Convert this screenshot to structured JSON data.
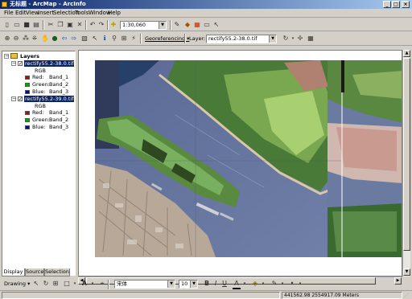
{
  "window": {
    "title": "无标题 - ArcMap - ArcInfo"
  },
  "menu": {
    "items": [
      "File",
      "Edit",
      "View",
      "Insert",
      "Selection",
      "Tools",
      "Window",
      "Help"
    ]
  },
  "standard_toolbar": {
    "scale_value": "1:30,060"
  },
  "georef_toolbar": {
    "georeferencing_label": "Georeferencing ▾",
    "layer_label": "Layer:",
    "layer_value": "rectify55.2-38.0.tif"
  },
  "toc": {
    "root_label": "Layers",
    "layers": [
      {
        "name": "rectify55.2-38.0.tif",
        "render": "RGB",
        "bands": [
          {
            "label": "Red:",
            "band": "Band_1",
            "color": "#cc0000"
          },
          {
            "label": "Green:",
            "band": "Band_2",
            "color": "#00aa00"
          },
          {
            "label": "Blue:",
            "band": "Band_3",
            "color": "#0000cc"
          }
        ]
      },
      {
        "name": "rectify55.2-39.0.tif",
        "render": "RGB",
        "bands": [
          {
            "label": "Red:",
            "band": "Band_1",
            "color": "#cc0000"
          },
          {
            "label": "Green:",
            "band": "Band_2",
            "color": "#00aa00"
          },
          {
            "label": "Blue:",
            "band": "Band_3",
            "color": "#0000cc"
          }
        ]
      }
    ],
    "tabs": [
      "Display",
      "Source",
      "Selection"
    ]
  },
  "draw_toolbar": {
    "drawing_label": "Drawing ▾",
    "font_name": "宋体",
    "font_size": "10"
  },
  "status": {
    "coords": "441562.98  2554917.09 Meters"
  }
}
